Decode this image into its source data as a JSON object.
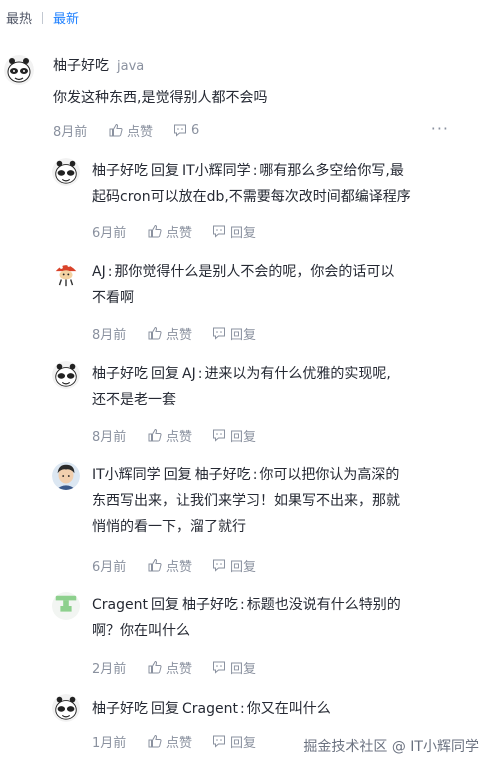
{
  "tabs": {
    "hot": "最热",
    "new": "最新"
  },
  "root": {
    "user": "柚子好吃",
    "tag": "java",
    "content": "你发这种东西,是觉得别人都不会吗",
    "time": "8月前",
    "like_label": "点赞",
    "reply_count": "6"
  },
  "reply_word": "回复",
  "replies": [
    {
      "user": "柚子好吃",
      "target": "IT小辉同学",
      "line1": "哪有那么多空给你写,最",
      "line2": "起码cron可以放在db,不需要每次改时间都编译程序",
      "time": "6月前",
      "like": "点赞",
      "reply": "回复"
    },
    {
      "user": "AJ",
      "target": "",
      "line1": "那你觉得什么是别人不会的呢，你会的话可以",
      "line2": "不看啊",
      "time": "8月前",
      "like": "点赞",
      "reply": "回复"
    },
    {
      "user": "柚子好吃",
      "target": "AJ",
      "line1": "进来以为有什么优雅的实现呢,",
      "line2": "还不是老一套",
      "time": "8月前",
      "like": "点赞",
      "reply": "回复"
    },
    {
      "user": "IT小辉同学",
      "target": "柚子好吃",
      "line1": "你可以把你认为高深的",
      "line2": "东西写出来，让我们来学习！如果写不出来，那就",
      "line3": "悄悄的看一下，溜了就行",
      "time": "6月前",
      "like": "点赞",
      "reply": "回复"
    },
    {
      "user": "Cragent",
      "target": "柚子好吃",
      "line1": "标题也没说有什么特别的",
      "line2": "啊？你在叫什么",
      "time": "2月前",
      "like": "点赞",
      "reply": "回复"
    },
    {
      "user": "柚子好吃",
      "target": "Cragent",
      "line1": "你又在叫什么",
      "time": "1月前",
      "like": "点赞",
      "reply": "回复"
    }
  ],
  "watermark": "掘金技术社区 @ IT小辉同学"
}
